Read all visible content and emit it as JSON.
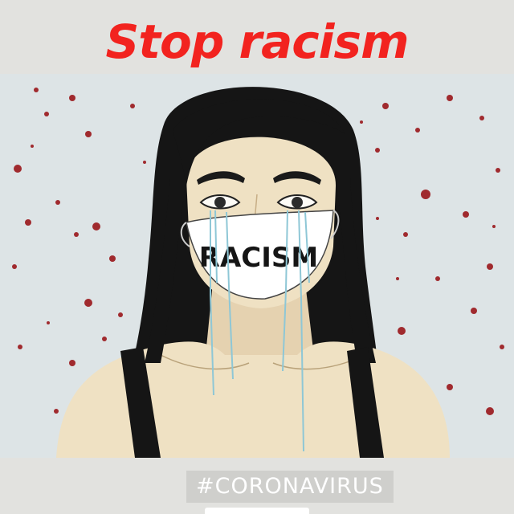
{
  "headline": "Stop racism",
  "mask_text": "RACISM",
  "hashtag": "#CORONAVIRUS",
  "colors": {
    "background": "#e2e2df",
    "artwork_background": "#dde4e6",
    "headline": "#f2231f",
    "hair": "#151515",
    "skin": "#efe1c3",
    "mask": "#ffffff",
    "tears": "#8ec7d6",
    "splatter": "#a02a2e"
  }
}
